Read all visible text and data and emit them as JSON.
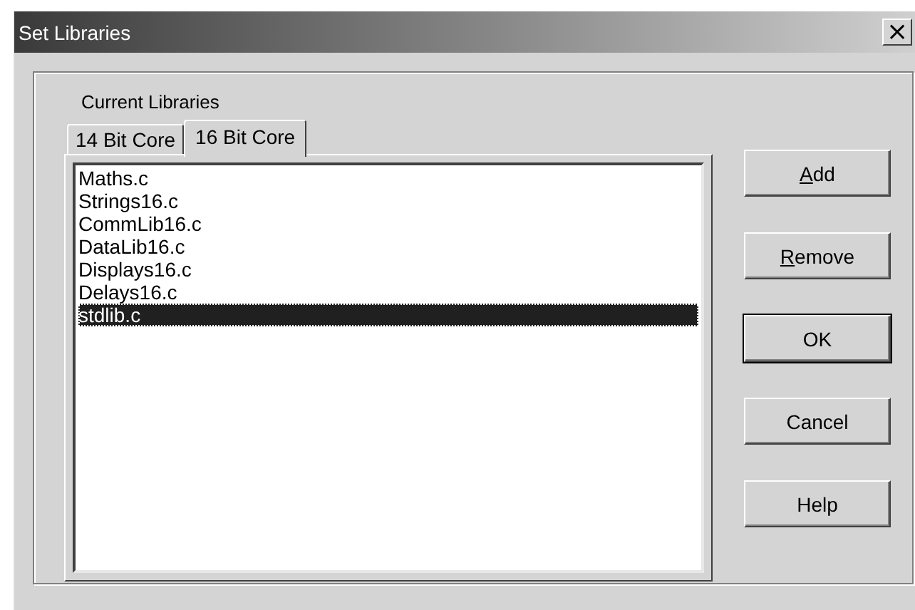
{
  "window": {
    "title": "Set Libraries",
    "close_glyph": "×"
  },
  "group": {
    "label": "Current Libraries"
  },
  "tabs": [
    {
      "label": "14 Bit Core",
      "selected": false
    },
    {
      "label": "16 Bit Core",
      "selected": true
    }
  ],
  "files": [
    {
      "name": "Maths.c",
      "selected": false
    },
    {
      "name": "Strings16.c",
      "selected": false
    },
    {
      "name": "CommLib16.c",
      "selected": false
    },
    {
      "name": "DataLib16.c",
      "selected": false
    },
    {
      "name": "Displays16.c",
      "selected": false
    },
    {
      "name": "Delays16.c",
      "selected": false
    },
    {
      "name": "stdlib.c",
      "selected": true
    }
  ],
  "buttons": [
    {
      "label": "Add",
      "underline_first": true,
      "default": false
    },
    {
      "label": "Remove",
      "underline_first": true,
      "default": false
    },
    {
      "label": "OK",
      "underline_first": false,
      "default": true
    },
    {
      "label": "Cancel",
      "underline_first": false,
      "default": false
    },
    {
      "label": "Help",
      "underline_first": false,
      "default": false
    }
  ]
}
